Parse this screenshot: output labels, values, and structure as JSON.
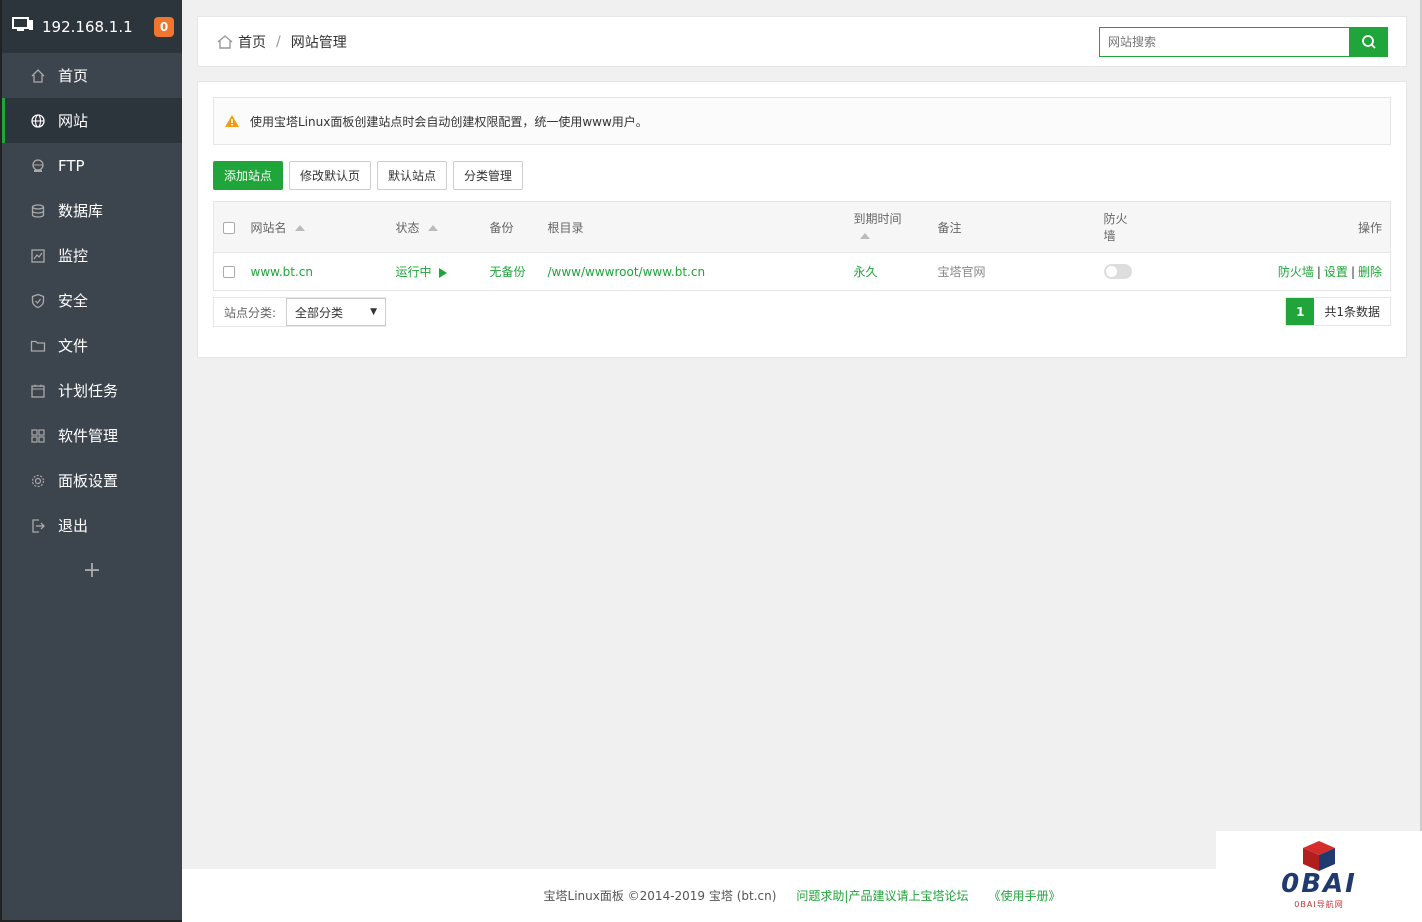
{
  "sidebar": {
    "ip": "192.168.1.1",
    "badge": "0",
    "items": [
      {
        "label": "首页",
        "icon": "home-icon"
      },
      {
        "label": "网站",
        "icon": "globe-icon"
      },
      {
        "label": "FTP",
        "icon": "ftp-icon"
      },
      {
        "label": "数据库",
        "icon": "database-icon"
      },
      {
        "label": "监控",
        "icon": "monitor-icon"
      },
      {
        "label": "安全",
        "icon": "shield-icon"
      },
      {
        "label": "文件",
        "icon": "folder-icon"
      },
      {
        "label": "计划任务",
        "icon": "calendar-icon"
      },
      {
        "label": "软件管理",
        "icon": "apps-icon"
      },
      {
        "label": "面板设置",
        "icon": "gear-icon"
      },
      {
        "label": "退出",
        "icon": "logout-icon"
      }
    ],
    "add": "+"
  },
  "header": {
    "breadcrumb_home": "首页",
    "breadcrumb_sep": "/",
    "breadcrumb_current": "网站管理",
    "search_placeholder": "网站搜索"
  },
  "notice": "使用宝塔Linux面板创建站点时会自动创建权限配置，统一使用www用户。",
  "buttons": {
    "add_site": "添加站点",
    "edit_default_page": "修改默认页",
    "default_site": "默认站点",
    "category_manage": "分类管理"
  },
  "table": {
    "headers": {
      "name": "网站名",
      "status": "状态",
      "backup": "备份",
      "root": "根目录",
      "expire": "到期时间",
      "remark": "备注",
      "firewall": "防火墙",
      "ops": "操作"
    },
    "rows": [
      {
        "name": "www.bt.cn",
        "status": "运行中",
        "backup": "无备份",
        "root": "/www/wwwroot/www.bt.cn",
        "expire": "永久",
        "remark": "宝塔官网",
        "firewall_on": false,
        "ops": [
          "防火墙",
          "设置",
          "删除"
        ]
      }
    ]
  },
  "category": {
    "label": "站点分类:",
    "selected": "全部分类"
  },
  "pager": {
    "current": "1",
    "total": "共1条数据"
  },
  "footer": {
    "copyright": "宝塔Linux面板 ©2014-2019 宝塔 (bt.cn)",
    "help": "问题求助|产品建议请上宝塔论坛",
    "manual": "《使用手册》"
  },
  "watermark": {
    "text": "0BAI",
    "sub": "0BAI导航网"
  },
  "colors": {
    "accent": "#20a53a",
    "sidebar": "#3c444d",
    "sidebar_dark": "#2c343c",
    "badge": "#f0752f"
  }
}
